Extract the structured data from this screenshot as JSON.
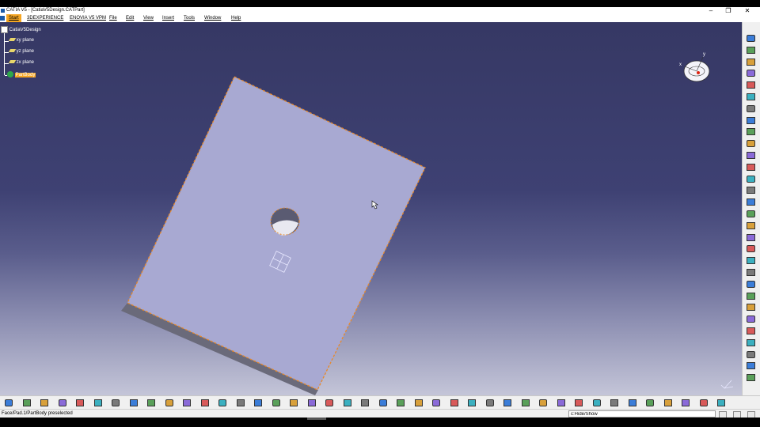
{
  "title": "CATIA V5 - [CatiaV5Design.CATPart]",
  "window_buttons": [
    "–",
    "❐",
    "✕"
  ],
  "menu": [
    {
      "label": "Start",
      "active": true
    },
    {
      "label": "3DEXPERIENCE"
    },
    {
      "label": "ENOVIA V5 VPM"
    },
    {
      "label": "File"
    },
    {
      "label": "Edit"
    },
    {
      "label": "View"
    },
    {
      "label": "Insert"
    },
    {
      "label": "Tools"
    },
    {
      "label": "Window"
    },
    {
      "label": "Help"
    }
  ],
  "tree": {
    "root": "CatiaV5Design",
    "items": [
      "xy plane",
      "yz plane",
      "zx plane"
    ],
    "selected": "PartBody"
  },
  "compass": {
    "x_label": "x",
    "y_label": "y"
  },
  "status": {
    "text": "Face/Pad.1/PartBody preselected",
    "command": "c:Hide/Show"
  },
  "colors": {
    "accent": "#f5a623",
    "plate_face": "#a8a9d2",
    "plate_edge": "#e8892a",
    "plate_side": "#6a6a7a"
  },
  "icons": {
    "right_toolbar": [
      "compass-icon",
      "sketch-icon",
      "sketch-icon",
      "sketch-icon",
      "select-arrow-icon",
      "sketch-icon",
      "pad-icon",
      "pocket-icon",
      "shaft-icon",
      "hole-icon",
      "rib-icon",
      "slot-icon",
      "stiffener-icon",
      "loft-icon",
      "remove-loft-icon",
      "solid-combine-icon",
      "fillet-icon",
      "chamfer-icon",
      "draft-icon",
      "shell-icon",
      "thickness-icon",
      "thread-icon",
      "translate-icon",
      "mirror-icon",
      "pattern-icon",
      "scaling-icon",
      "boolean-icon",
      "split-icon",
      "measure-icon",
      "catia-logo-icon"
    ],
    "bottom_toolbar": [
      "new-icon",
      "open-icon",
      "save-icon",
      "print-icon",
      "cut-icon",
      "copy-icon",
      "paste-icon",
      "undo-icon",
      "redo-icon",
      "whats-this-icon",
      "formula-icon",
      "knowledge-icon",
      "table-icon",
      "view-icon",
      "apply-material-icon",
      "fit-all-icon",
      "pan-icon",
      "rotate-icon",
      "zoom-in-icon",
      "zoom-out-icon",
      "normal-view-icon",
      "isometric-view-icon",
      "render-style-icon",
      "hide-show-icon",
      "swap-visible-icon",
      "update-icon",
      "measure-icon",
      "analysis-icon",
      "axis-icon",
      "point-icon",
      "line-icon",
      "plane-icon",
      "sketch-icon",
      "constraint-icon",
      "snap-icon",
      "parallelism-icon",
      "hide-icon",
      "measure-icon",
      "catalog-icon",
      "render-icon",
      "eraser-icon"
    ]
  }
}
